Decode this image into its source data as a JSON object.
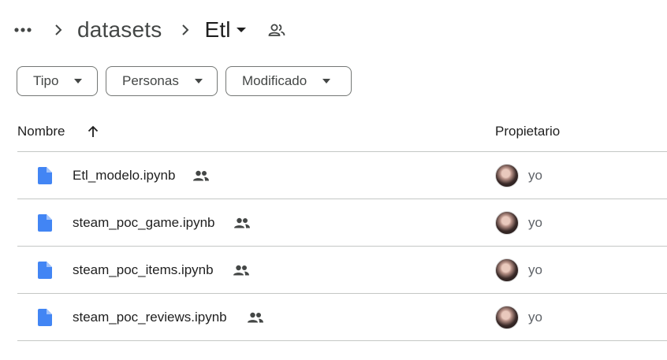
{
  "breadcrumb": {
    "more_icon": "more-horiz-icon",
    "separator_icon": "chevron-right-icon",
    "parent": "datasets",
    "current": "Etl",
    "dropdown_icon": "arrow-drop-down-icon",
    "shared_icon": "people-outline-icon"
  },
  "filters": [
    {
      "label": "Tipo",
      "icon": "arrow-drop-down-icon"
    },
    {
      "label": "Personas",
      "icon": "arrow-drop-down-icon"
    },
    {
      "label": "Modificado",
      "icon": "arrow-drop-down-icon"
    }
  ],
  "table": {
    "columns": {
      "name": "Nombre",
      "owner": "Propietario"
    },
    "sort_icon": "arrow-upward-icon",
    "rows": [
      {
        "name": "Etl_modelo.ipynb",
        "file_icon": "doc-file-icon",
        "shared_icon": "people-icon",
        "owner": "yo"
      },
      {
        "name": "steam_poc_game.ipynb",
        "file_icon": "doc-file-icon",
        "shared_icon": "people-icon",
        "owner": "yo"
      },
      {
        "name": "steam_poc_items.ipynb",
        "file_icon": "doc-file-icon",
        "shared_icon": "people-icon",
        "owner": "yo"
      },
      {
        "name": "steam_poc_reviews.ipynb",
        "file_icon": "doc-file-icon",
        "shared_icon": "people-icon",
        "owner": "yo"
      }
    ]
  },
  "colors": {
    "file_icon": "#4285f4",
    "icon_gray": "#444746",
    "divider": "#c4c7c5"
  }
}
